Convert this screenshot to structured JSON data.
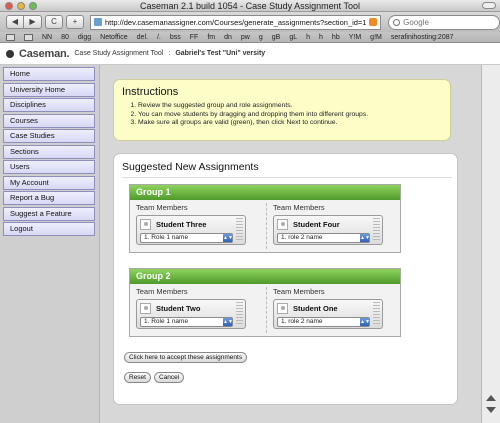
{
  "window": {
    "title": "Caseman 2.1 build 1054 - Case Study Assignment Tool"
  },
  "toolbar": {
    "back_glyph": "◀",
    "forward_glyph": "▶",
    "reload_glyph": "C",
    "add_glyph": "+",
    "url": "http://dev.casemanassigner.com/Courses/generate_assignments?section_id=12C",
    "search_placeholder": "Google"
  },
  "bookmarks": [
    "NN",
    "80",
    "digg",
    "Netoffice",
    "del.",
    "/.",
    "bss",
    "FF",
    "fm",
    "dn",
    "pw",
    "g",
    "gB",
    "gL",
    "h",
    "h",
    "hb",
    "Y!M",
    "g!M",
    "serafinihosting:2087"
  ],
  "header": {
    "logo": "Caseman.",
    "app_name": "Case Study Assignment Tool",
    "separator": ":",
    "course": "Gabriel's Test \"Uni\" versity"
  },
  "sidebar": {
    "items": [
      "Home",
      "University Home",
      "Disciplines",
      "Courses",
      "Case Studies",
      "Sections",
      "Users",
      "My Account",
      "Report a Bug",
      "Suggest a Feature",
      "Logout"
    ]
  },
  "instructions": {
    "title": "Instructions",
    "steps": [
      "Review the suggested group and role assignments.",
      "You can move students by dragging and dropping them into different groups.",
      "Make sure all groups are valid (green), then click Next to continue."
    ]
  },
  "assignments": {
    "title": "Suggested New Assignments",
    "groups": [
      {
        "name": "Group 1",
        "columns": [
          {
            "label": "Team Members",
            "student": "Student Three",
            "role": "1. Role 1 name"
          },
          {
            "label": "Team Members",
            "student": "Student Four",
            "role": "1. role 2 name"
          }
        ]
      },
      {
        "name": "Group 2",
        "columns": [
          {
            "label": "Team Members",
            "student": "Student Two",
            "role": "1. Role 1 name"
          },
          {
            "label": "Team Members",
            "student": "Student One",
            "role": "1. role 2 name"
          }
        ]
      }
    ],
    "accept_label": "Click here to accept these assignments",
    "reset_label": "Reset",
    "cancel_label": "Cancel"
  },
  "colors": {
    "valid_group": "#5fad34",
    "instructions_bg": "#fdfdc8",
    "nav_bg": "#e4e4f8"
  }
}
